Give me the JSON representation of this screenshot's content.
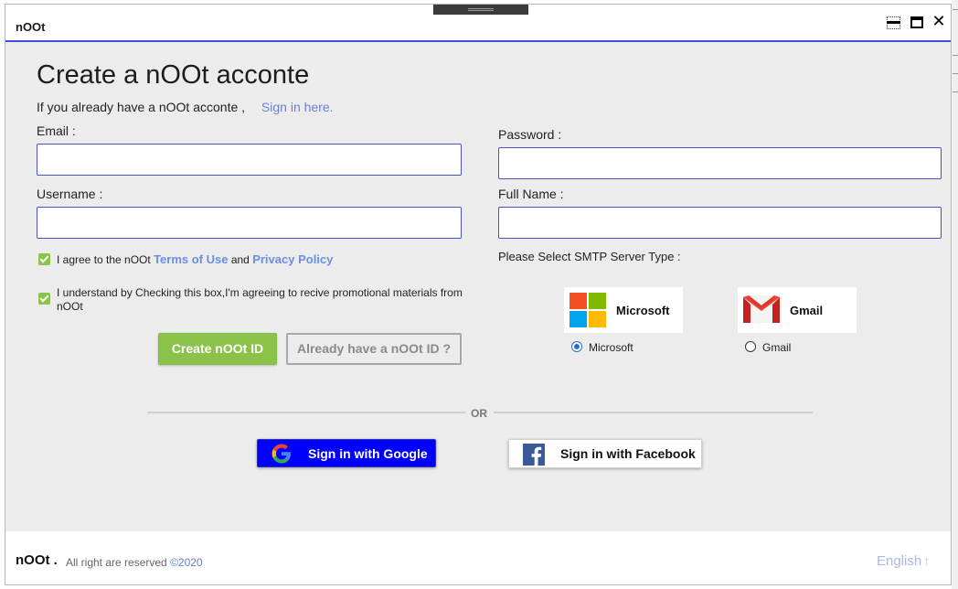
{
  "window": {
    "title": "nOOt"
  },
  "window_controls": {
    "close_glyph": "✕"
  },
  "heading": "Create a nOOt acconte",
  "subline": {
    "text": "If you already have a nOOt acconte ,",
    "link": "Sign in here."
  },
  "form": {
    "email_label": "Email :",
    "email_value": "",
    "password_label": "Password :",
    "password_value": "",
    "username_label": "Username :",
    "username_value": "",
    "fullname_label": "Full Name :",
    "fullname_value": ""
  },
  "agreements": {
    "terms": {
      "prefix": "I agree to the nOOt",
      "terms_link": "Terms of Use",
      "and": "and",
      "privacy_link": "Privacy Policy",
      "checked": true
    },
    "promo": {
      "text": "I understand by Checking this box,I'm agreeing to recive promotional materials from nOOt",
      "checked": true
    }
  },
  "buttons": {
    "create": "Create nOOt ID",
    "already": "Already have a nOOt ID ?"
  },
  "smtp": {
    "label": "Please Select SMTP Server Type :",
    "options": [
      {
        "name": "Microsoft",
        "radio_label": "Microsoft",
        "selected": true,
        "icon": "microsoft-logo-icon"
      },
      {
        "name": "Gmail",
        "radio_label": "Gmail",
        "selected": false,
        "icon": "gmail-logo-icon"
      }
    ]
  },
  "or_text": "OR",
  "social": {
    "google": "Sign in with Google",
    "facebook": "Sign in with Facebook"
  },
  "footer": {
    "brand": "nOOt .",
    "rights": "All right are reserved",
    "copyright": "©2020",
    "language": "English",
    "language_icon": "arrow-up-icon"
  },
  "colors": {
    "accent": "#3d52d6",
    "green": "#8bc34a",
    "google_button": "#0000ff",
    "facebook": "#3b5998",
    "link": "#6b7fd7"
  }
}
